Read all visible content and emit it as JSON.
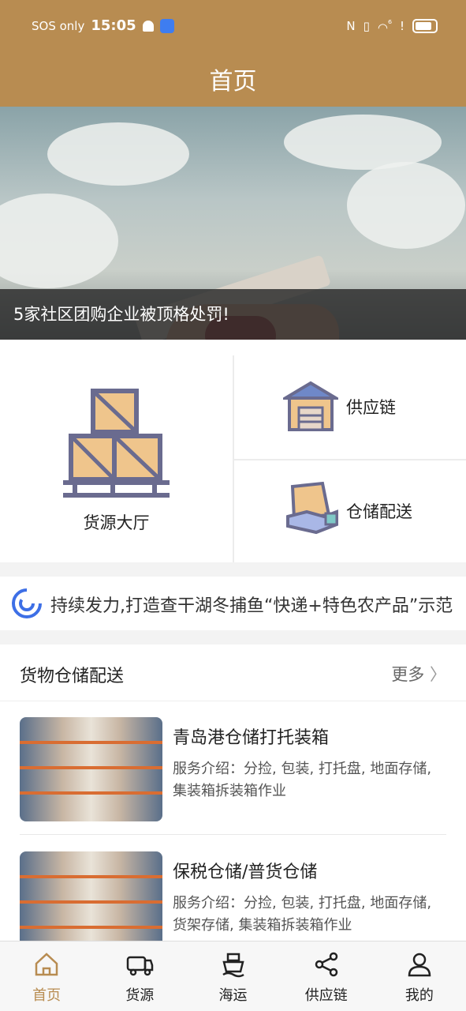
{
  "status": {
    "carrier": "SOS only",
    "time": "15:05",
    "net": "⁶"
  },
  "header": {
    "title": "首页"
  },
  "banner": {
    "caption": "5家社区团购企业被顶格处罚!"
  },
  "categories": {
    "main": {
      "label": "货源大厅",
      "icon": "boxes-pallet-icon"
    },
    "supply": {
      "label": "供应链",
      "icon": "warehouse-icon"
    },
    "delivery": {
      "label": "仓储配送",
      "icon": "hand-box-icon"
    }
  },
  "marquee": {
    "text": "持续发力,打造查干湖冬捕鱼“快递+特色农产品”示范"
  },
  "section": {
    "title": "货物仓储配送",
    "more": "更多",
    "items": [
      {
        "title": "青岛港仓储打托装箱",
        "desc": "服务介绍：分捡, 包装, 打托盘, 地面存储, 集装箱拆装箱作业"
      },
      {
        "title": "保税仓储/普货仓储",
        "desc": "服务介绍：分捡, 包装, 打托盘, 地面存储, 货架存储, 集装箱拆装箱作业"
      }
    ]
  },
  "nav": [
    {
      "label": "首页",
      "icon": "home-icon",
      "active": true
    },
    {
      "label": "货源",
      "icon": "truck-icon"
    },
    {
      "label": "海运",
      "icon": "ship-icon"
    },
    {
      "label": "供应链",
      "icon": "share-icon"
    },
    {
      "label": "我的",
      "icon": "user-icon"
    }
  ],
  "colors": {
    "brand": "#b88c51",
    "icon_stroke": "#6a6b8f",
    "box": "#efc58c"
  }
}
